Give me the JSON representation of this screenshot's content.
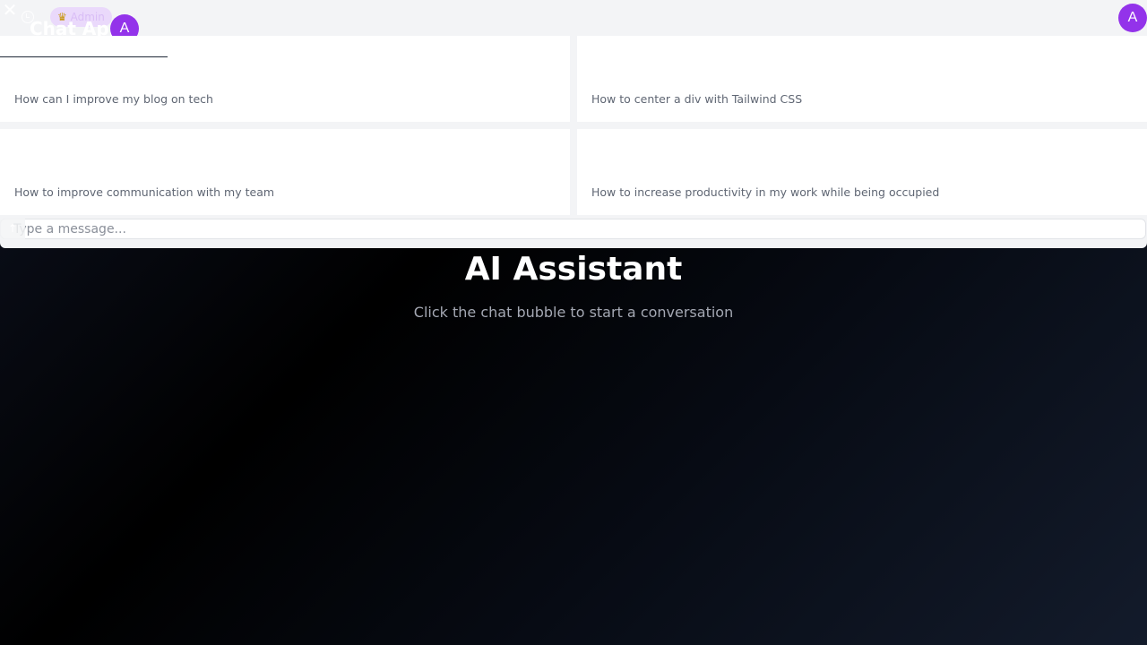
{
  "hero": {
    "title": "AI Assistant",
    "subtitle": "Click the chat bubble to start a conversation"
  },
  "chat": {
    "header": {
      "app_title": "Chat App",
      "badge_icon": "crown-icon",
      "badge_label": "Admin",
      "avatar_initial": "A",
      "user_avatar_initial": "A",
      "close_icon": "close-icon",
      "history_icon": "history-icon"
    },
    "suggestions": [
      {
        "label": "How can I improve my blog on tech"
      },
      {
        "label": "How to center a div with Tailwind CSS"
      },
      {
        "label": "How to improve communication with my team"
      },
      {
        "label": "How to increase productivity in my work while being occupied"
      }
    ],
    "input": {
      "placeholder": "Type a message...",
      "value": "",
      "send_icon": "send-arrow-icon"
    }
  },
  "colors": {
    "accent": "#9333ea",
    "panel_bg": "#f3f4f6",
    "badge_bg": "#ead9fb"
  }
}
